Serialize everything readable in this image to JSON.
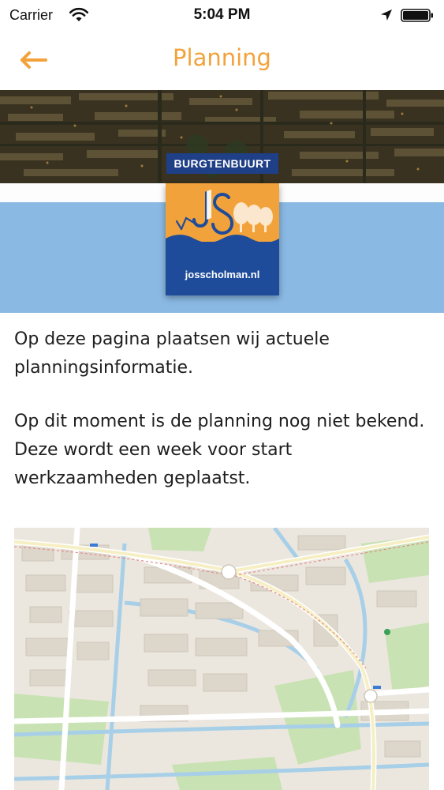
{
  "status_bar": {
    "carrier": "Carrier",
    "time": "5:04 PM",
    "icons": [
      "wifi-icon",
      "location-arrow-icon",
      "battery-icon"
    ]
  },
  "nav": {
    "title": "Planning",
    "back_icon": "arrow-left-icon",
    "accent_color": "#f2a23a"
  },
  "header": {
    "badge": "BURGTENBUURT",
    "logo_url": "josscholman.nl",
    "colors": {
      "logo_orange": "#f2a23a",
      "logo_blue": "#1f4c9a",
      "band_blue": "#8ab9e4"
    }
  },
  "content": {
    "paragraph_1": "Op deze pagina plaatsen wij actuele planningsinformatie.",
    "paragraph_2": "Op dit moment is de planning nog niet bekend. Deze wordt een week voor start werkzaamheden geplaatst."
  },
  "map": {
    "type": "street-map"
  }
}
